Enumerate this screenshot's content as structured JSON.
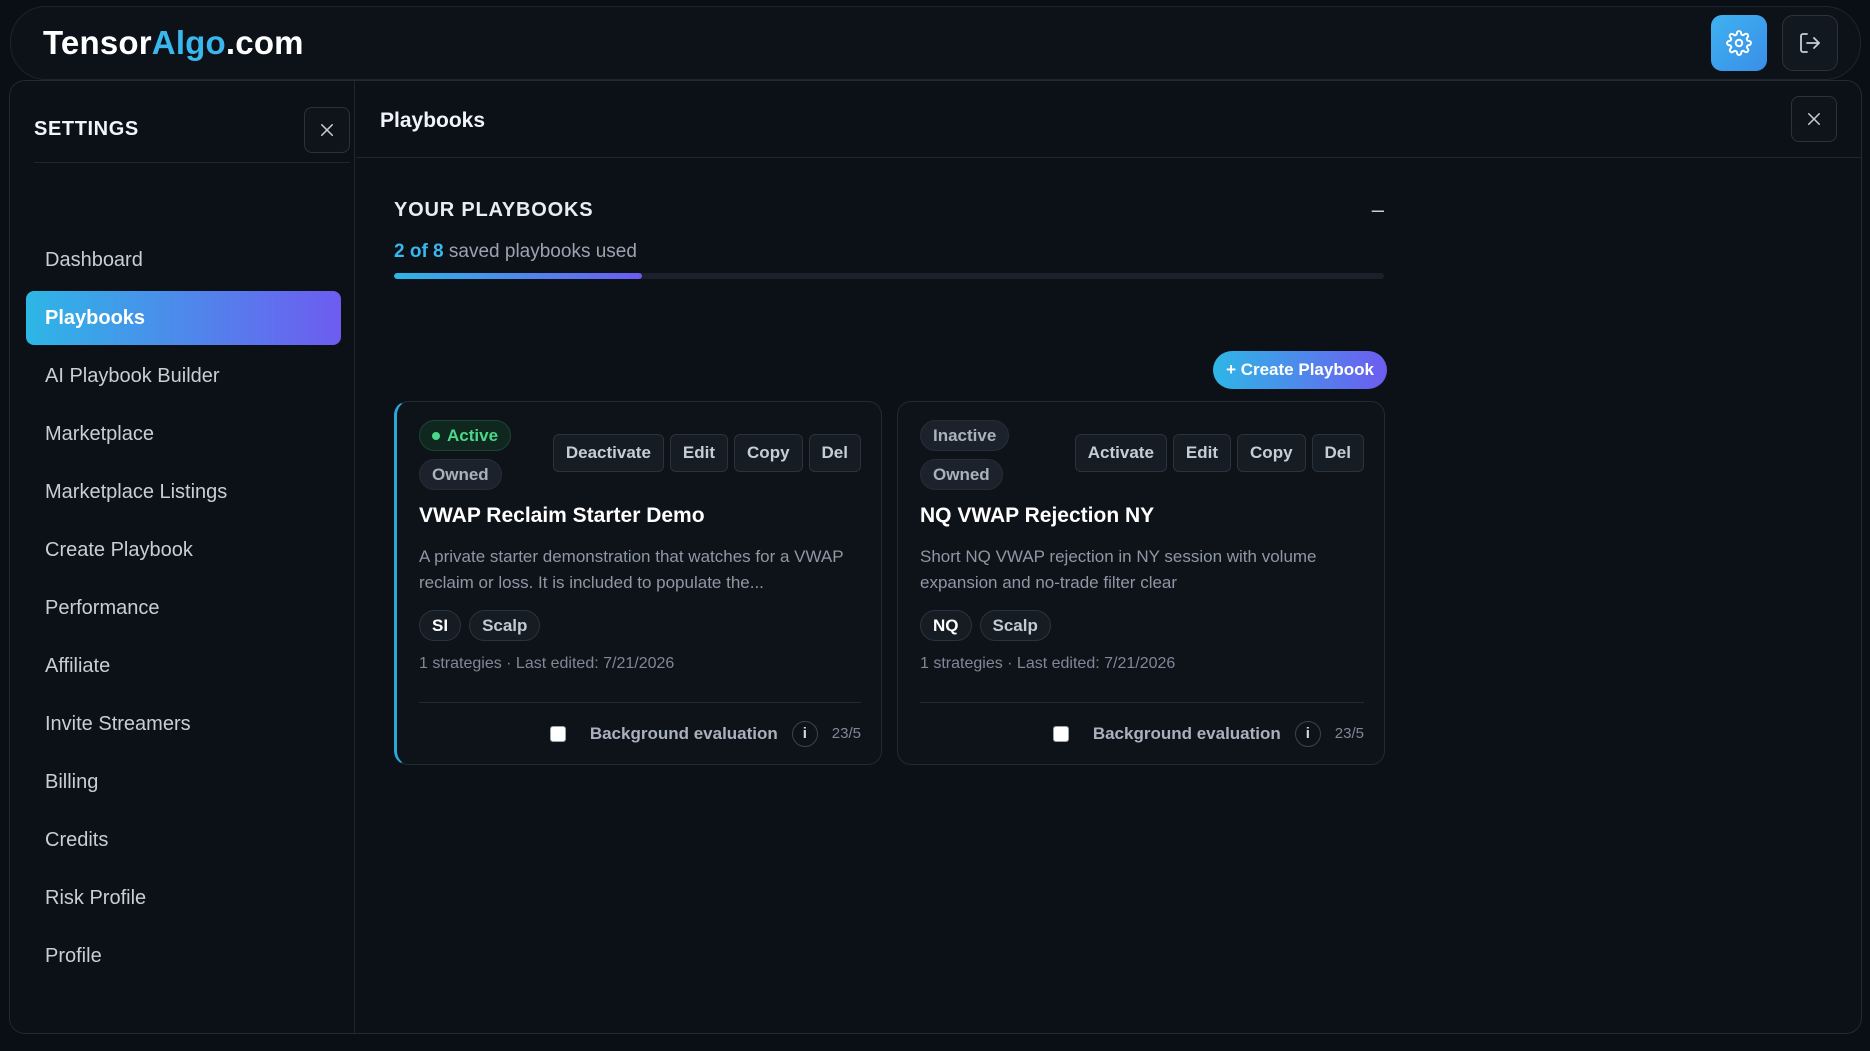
{
  "header": {
    "logo_part1": "Tensor",
    "logo_part2": "Algo",
    "logo_part3": ".com",
    "settings_icon": "gear-icon",
    "logout_icon": "logout-icon",
    "accent_color": "#39b7ee"
  },
  "sidebar": {
    "title": "SETTINGS",
    "items": [
      {
        "label": "Dashboard"
      },
      {
        "label": "Playbooks"
      },
      {
        "label": "AI Playbook Builder"
      },
      {
        "label": "Marketplace"
      },
      {
        "label": "Marketplace Listings"
      },
      {
        "label": "Create Playbook"
      },
      {
        "label": "Performance"
      },
      {
        "label": "Affiliate"
      },
      {
        "label": "Invite Streamers"
      },
      {
        "label": "Billing"
      },
      {
        "label": "Credits"
      },
      {
        "label": "Risk Profile"
      },
      {
        "label": "Profile"
      }
    ],
    "active_item": "Playbooks"
  },
  "content": {
    "title": "Playbooks",
    "section_title": "YOUR PLAYBOOKS",
    "collapse_label": "–",
    "usage_count": "2 of 8",
    "usage_text": " saved playbooks used",
    "usage_fraction": 0.25,
    "create_button": "+ Create Playbook"
  },
  "playbooks": [
    {
      "status": "Active",
      "ownership": "Owned",
      "actions": [
        "Deactivate",
        "Edit",
        "Copy",
        "Del"
      ],
      "name": "VWAP Reclaim Starter Demo",
      "description": "A private starter demonstration that watches for a VWAP reclaim or loss. It is included to populate the...",
      "symbol": "SI",
      "style": "Scalp",
      "meta": "1 strategies · Last edited: 7/21/2026",
      "bg_eval_label": "Background evaluation",
      "info": "i",
      "count": "23/5"
    },
    {
      "status": "Inactive",
      "ownership": "Owned",
      "actions": [
        "Activate",
        "Edit",
        "Copy",
        "Del"
      ],
      "name": "NQ VWAP Rejection NY",
      "description": "Short NQ VWAP rejection in NY session with volume expansion and no-trade filter clear",
      "symbol": "NQ",
      "style": "Scalp",
      "meta": "1 strategies · Last edited: 7/21/2026",
      "bg_eval_label": "Background evaluation",
      "info": "i",
      "count": "23/5"
    }
  ]
}
